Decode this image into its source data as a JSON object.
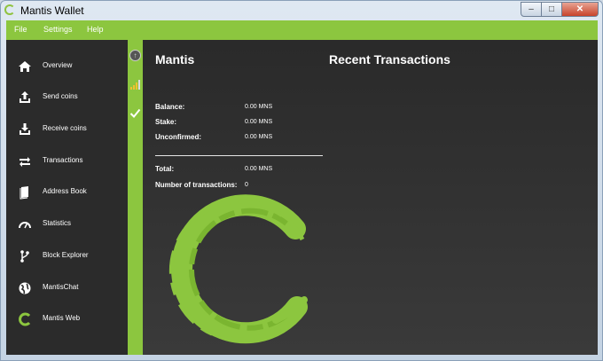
{
  "window": {
    "title": "Mantis Wallet",
    "min": "–",
    "max": "□",
    "close": "✕"
  },
  "menu": {
    "items": [
      "File",
      "Settings",
      "Help"
    ]
  },
  "sidebar": {
    "items": [
      {
        "label": "Overview",
        "icon": "home-icon"
      },
      {
        "label": "Send coins",
        "icon": "upload-icon"
      },
      {
        "label": "Receive coins",
        "icon": "download-icon"
      },
      {
        "label": "Transactions",
        "icon": "transfer-icon"
      },
      {
        "label": "Address Book",
        "icon": "book-icon"
      },
      {
        "label": "Statistics",
        "icon": "gauge-icon"
      },
      {
        "label": "Block Explorer",
        "icon": "branch-icon"
      },
      {
        "label": "MantisChat",
        "icon": "globe-icon"
      },
      {
        "label": "Mantis Web",
        "icon": "mantis-ring-icon"
      }
    ]
  },
  "overview": {
    "title": "Mantis",
    "recent_title": "Recent Transactions",
    "balance_label": "Balance:",
    "balance_value": "0.00 MNS",
    "stake_label": "Stake:",
    "stake_value": "0.00 MNS",
    "unconfirmed_label": "Unconfirmed:",
    "unconfirmed_value": "0.00 MNS",
    "total_label": "Total:",
    "total_value": "0.00 MNS",
    "txcount_label": "Number of transactions:",
    "txcount_value": "0"
  },
  "colors": {
    "accent": "#8cc63f",
    "sidebar": "#2b2b2b",
    "main": "#303030"
  }
}
